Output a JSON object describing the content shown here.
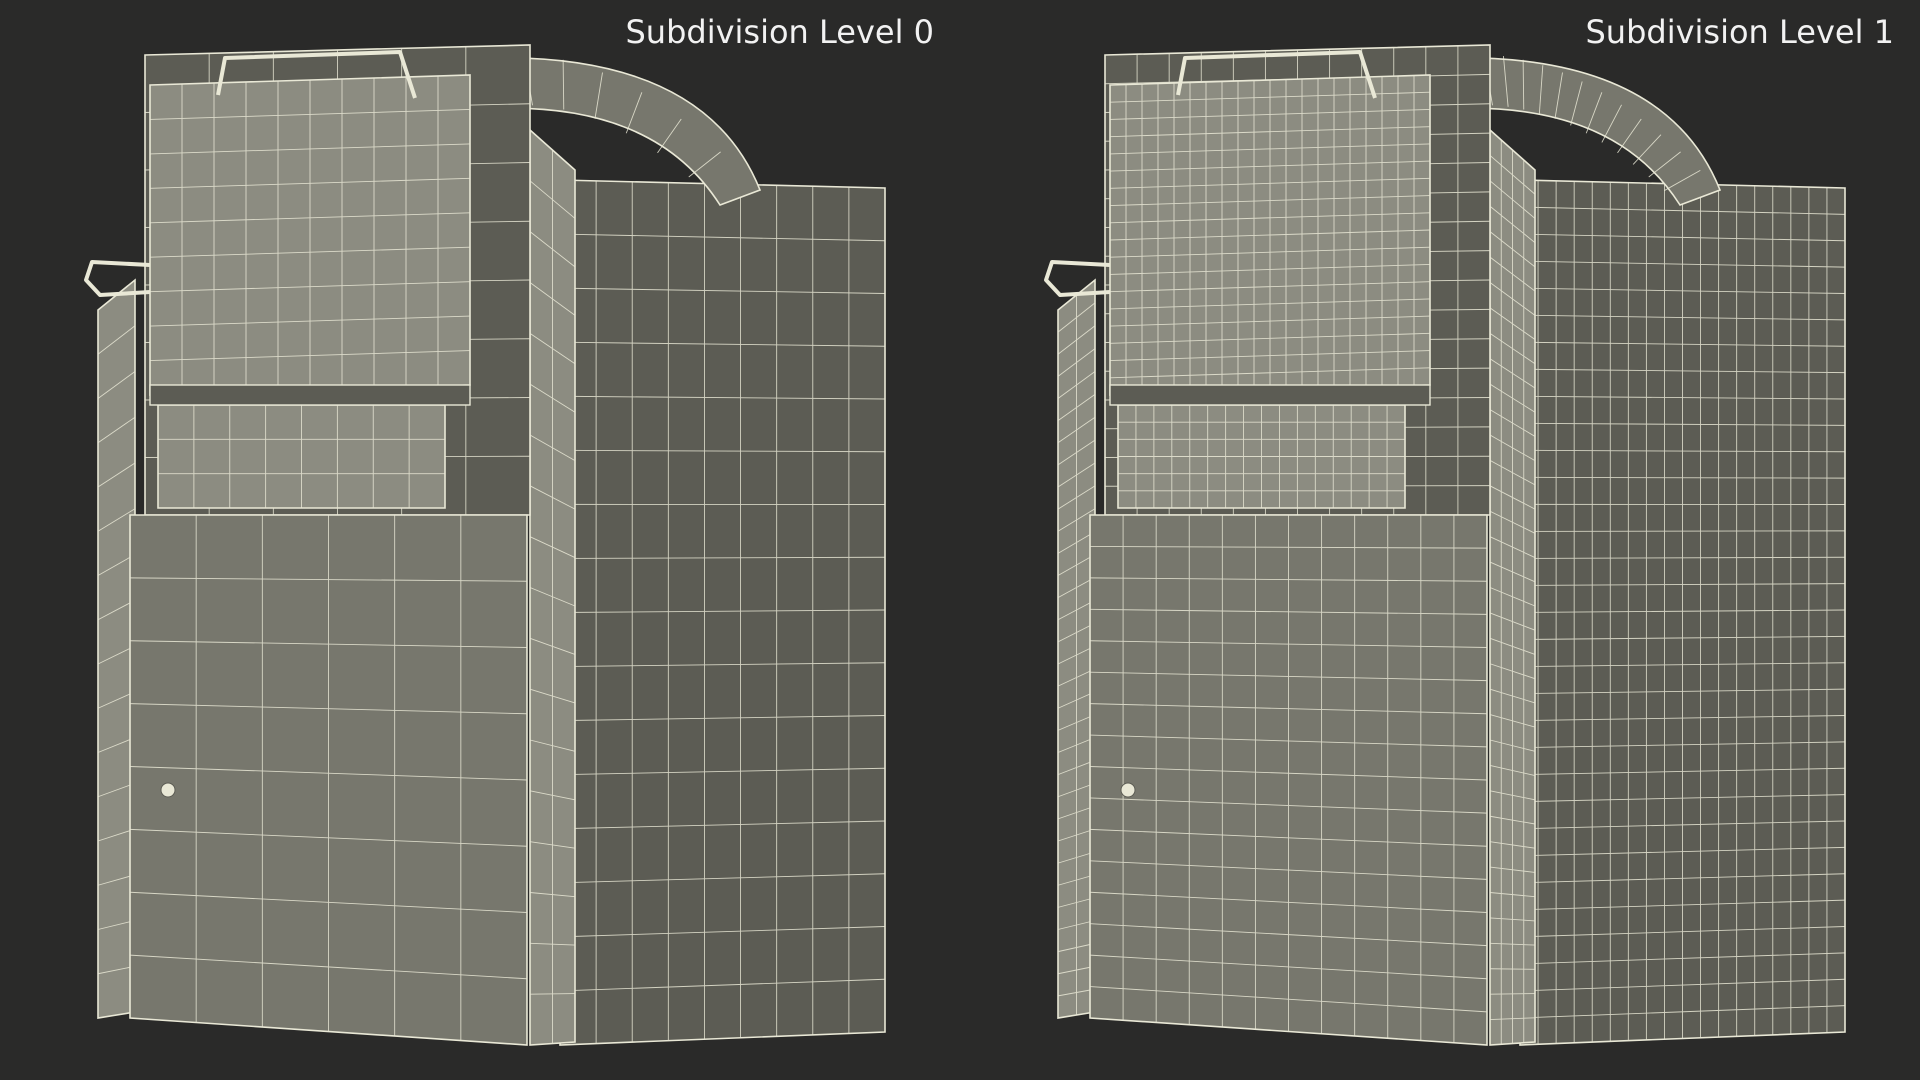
{
  "labels": {
    "left": "Subdivision Level 0",
    "right": "Subdivision Level 1"
  },
  "colors": {
    "background": "#2a2a29",
    "surface": "#77776d",
    "surface_light": "#8c8c81",
    "surface_dark": "#5c5c54",
    "wire": "#e9e8d6",
    "text": "#f2f2f2"
  },
  "panels": [
    {
      "name": "subdivision-level-0",
      "grid_density": 1
    },
    {
      "name": "subdivision-level-1",
      "grid_density": 2
    }
  ]
}
